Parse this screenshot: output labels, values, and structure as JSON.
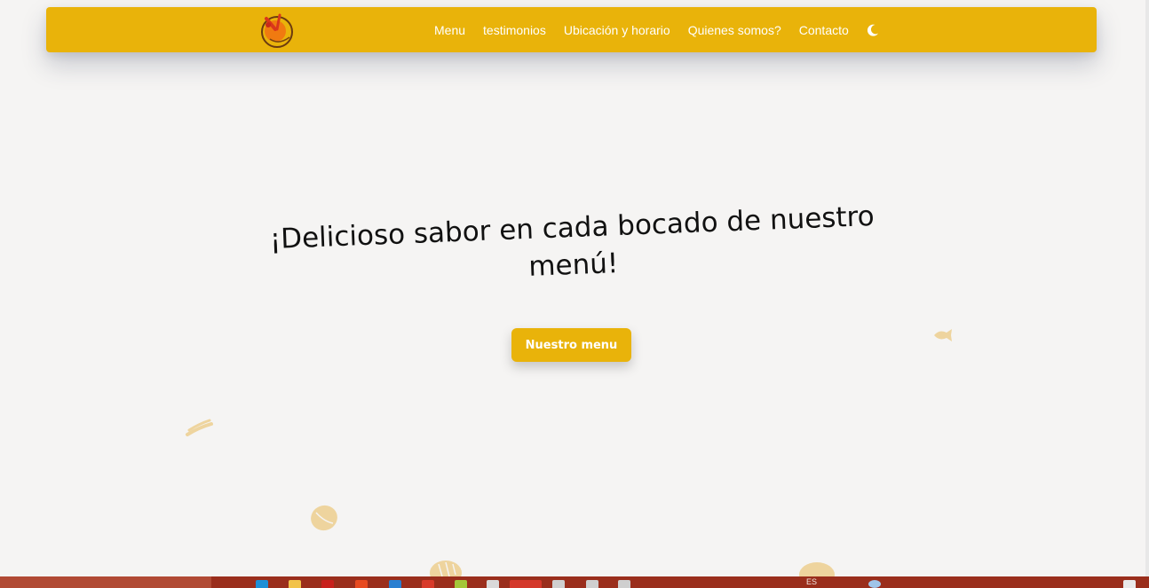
{
  "nav": {
    "logo_name": "burger-logo",
    "links": [
      "Menu",
      "testimonios",
      "Ubicación y horario",
      "Quienes somos?",
      "Contacto"
    ],
    "theme_icon": "moon-icon"
  },
  "hero": {
    "title": "¡Delicioso sabor en cada bocado de nuestro menú!",
    "button_label": "Nuestro menu"
  },
  "colors": {
    "accent": "#e9b30a",
    "background": "#f5f4f3",
    "text": "#111111",
    "taskbar": "#9a2e1c"
  },
  "taskbar": {
    "language": "ES"
  }
}
